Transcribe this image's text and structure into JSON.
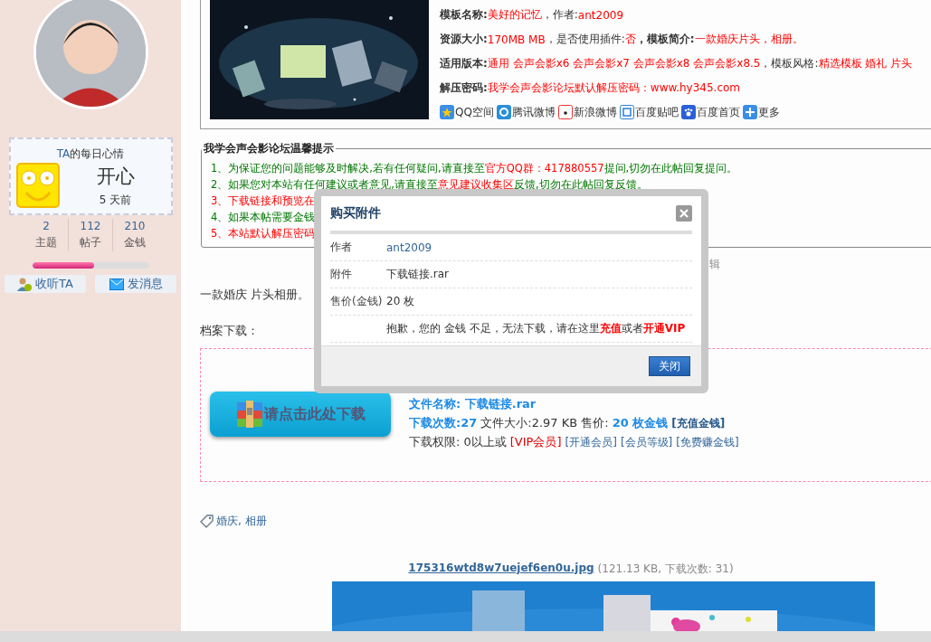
{
  "sidebar": {
    "mood": {
      "title_prefix": "TA",
      "title": "的每日心情",
      "mood": "开心",
      "time": "5 天前"
    },
    "stats": [
      {
        "value": "2",
        "label": "主题"
      },
      {
        "value": "112",
        "label": "帖子"
      },
      {
        "value": "210",
        "label": "金钱"
      }
    ],
    "progress": {
      "level": 0.53
    },
    "buttons": [
      "收听TA",
      "发消息"
    ]
  },
  "template_info": {
    "rows": [
      {
        "parts": [
          {
            "kind": "label",
            "text": "模板名称:"
          },
          {
            "kind": "value",
            "text": "美好的记忆"
          },
          {
            "kind": "plain",
            "text": "，作者:"
          },
          {
            "kind": "value",
            "text": "ant2009"
          }
        ]
      },
      {
        "parts": [
          {
            "kind": "label",
            "text": "资源大小:"
          },
          {
            "kind": "value",
            "text": "170MB MB"
          },
          {
            "kind": "plain",
            "text": "，是否使用插件:"
          },
          {
            "kind": "value",
            "text": "否"
          },
          {
            "kind": "label",
            "text": "，模板简介:"
          },
          {
            "kind": "value",
            "text": "一款婚庆片头，相册。"
          }
        ]
      },
      {
        "parts": [
          {
            "kind": "label",
            "text": "适用版本:"
          },
          {
            "kind": "value",
            "text": "通用 会声会影x6 会声会影x7 会声会影x8 会声会影x8.5"
          },
          {
            "kind": "plain",
            "text": "，模板风格:"
          },
          {
            "kind": "value",
            "text": "精选模板 婚礼 片头"
          }
        ]
      },
      {
        "parts": [
          {
            "kind": "label",
            "text": "解压密码:"
          },
          {
            "kind": "value",
            "text": "我学会声会影论坛默认解压密码：www.hy345.com"
          }
        ]
      }
    ],
    "share": [
      "QQ空间",
      "腾讯微博",
      "新浪微博",
      "百度贴吧",
      "百度首页",
      "更多"
    ]
  },
  "notice": {
    "legend": "我学会声会影论坛温馨提示",
    "lines": [
      {
        "parts": [
          {
            "kind": "green",
            "text": "1、为保证您的问题能够及时解决,若有任何疑问,请直接至"
          },
          {
            "kind": "red",
            "text": "官方QQ群：417880557"
          },
          {
            "kind": "green",
            "text": "提问,切勿在此帖回复提问。"
          }
        ]
      },
      {
        "parts": [
          {
            "kind": "green",
            "text": "2、如果您对本站有任何建议或者意见,请直接至 "
          },
          {
            "kind": "red",
            "text": "意见建议收集区"
          },
          {
            "kind": "green",
            "text": " 反馈,切勿在此帖回复反馈。"
          }
        ]
      },
      {
        "parts": [
          {
            "kind": "red",
            "text": "3、下载链接和预览在"
          }
        ]
      },
      {
        "parts": [
          {
            "kind": "green",
            "text": "4、如果本帖需要金钱"
          }
        ]
      },
      {
        "parts": [
          {
            "kind": "red",
            "text": "5、本站默认解压密码"
          }
        ]
      }
    ]
  },
  "edit_link": "辑",
  "post_text": "一款婚庆 片头相册。",
  "download_heading": "档案下载：",
  "download": {
    "button": "请点击此处下载",
    "lines": [
      {
        "parts": [
          {
            "kind": "strong",
            "text": "文件名称: 下载链接.rar"
          }
        ]
      },
      {
        "parts": [
          {
            "kind": "strong",
            "text": "下载次数:27"
          },
          {
            "kind": "plain",
            "text": " 文件大小:2.97 KB  售价: "
          },
          {
            "kind": "strong",
            "text": "20 枚金钱"
          },
          {
            "kind": "boldlink",
            "text": "[充值金钱]"
          }
        ]
      },
      {
        "parts": [
          {
            "kind": "plain",
            "text": "下载权限: 0以上或"
          },
          {
            "kind": "red",
            "text": "[VIP会员]"
          },
          {
            "kind": "link",
            "text": "[开通会员]"
          },
          {
            "kind": "link",
            "text": "[会员等级]"
          },
          {
            "kind": "link",
            "text": "[免费赚金钱]"
          }
        ]
      }
    ]
  },
  "tags": "婚庆, 相册",
  "attachment": {
    "name": "175316wtd8w7uejef6en0u.jpg",
    "info": "(121.13 KB, 下载次数: 31)"
  },
  "dialog": {
    "title": "购买附件",
    "rows": [
      {
        "label": "作者",
        "value": "ant2009",
        "kind": "link"
      },
      {
        "label": "附件",
        "value": "下载链接.rar",
        "kind": "plain"
      },
      {
        "label": "售价(金钱)",
        "value": "20 枚",
        "kind": "plain"
      },
      {
        "label": "",
        "value": "抱歉，您的 金钱 不足，无法下载，请在这里**充值**或者**开通VIP**",
        "kind": "message"
      }
    ],
    "button": "关闭"
  }
}
